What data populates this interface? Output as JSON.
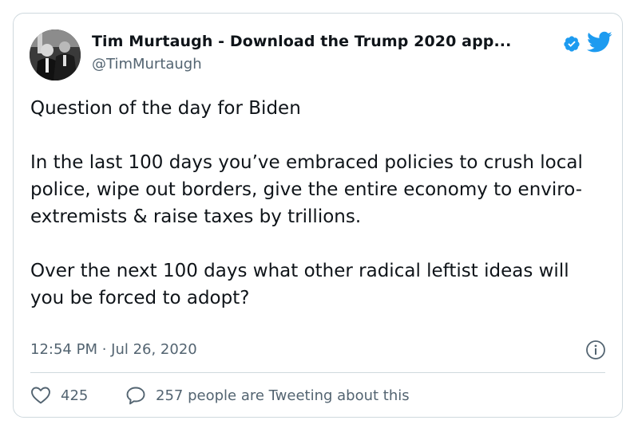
{
  "author": {
    "display_name": "Tim Murtaugh - Download the Trump 2020 app...",
    "handle": "@TimMurtaugh",
    "verified": true,
    "avatar_icon": "profile-photo"
  },
  "brand": {
    "icon": "twitter-bird-icon",
    "color": "#1d9bf0"
  },
  "tweet": {
    "text": "Question of the day for Biden\n\nIn the last 100 days you’ve embraced policies to crush local police, wipe out borders, give the entire economy to enviro-extremists & raise taxes by trillions.\n\nOver the next 100 days what other radical leftist ideas will you be forced to adopt?",
    "timestamp": "12:54 PM · Jul 26, 2020"
  },
  "actions": {
    "like_count": "425",
    "reply_text": "257 people are Tweeting about this"
  },
  "colors": {
    "text_primary": "#0f1419",
    "text_secondary": "#536471",
    "border": "#cfd9de"
  }
}
